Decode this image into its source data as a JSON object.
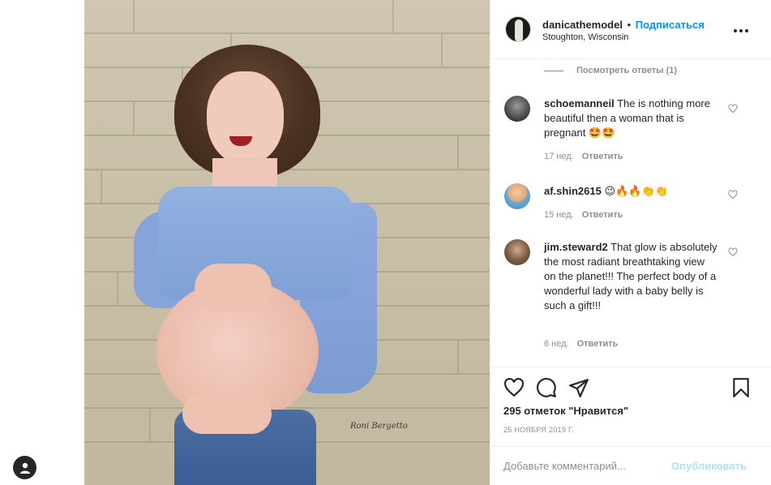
{
  "post": {
    "username": "danicathemodel",
    "separator": "•",
    "follow_label": "Подписаться",
    "location": "Stoughton, Wisconsin",
    "photo_signature": "Roni Bergetto"
  },
  "comments": {
    "view_replies": "Посмотреть ответы (1)",
    "items": [
      {
        "username": "schoemanneil",
        "text": "The is nothing more beautiful then a woman that is pregnant 🤩🤩",
        "age": "17 нед.",
        "reply_label": "Ответить"
      },
      {
        "username": "af.shin2615",
        "text": "😉🔥🔥👏👏",
        "age": "15 нед.",
        "reply_label": "Ответить"
      },
      {
        "username": "jim.steward2",
        "text": "That glow is absolutely the most radiant breathtaking view on the planet!!! The perfect body of a wonderful lady with a baby belly is such a gift!!!",
        "age": "6 нед.",
        "reply_label": "Ответить"
      }
    ]
  },
  "actions": {
    "likes": "295 отметок \"Нравится\"",
    "date": "25 НОЯБРЯ 2019 Г."
  },
  "composer": {
    "placeholder": "Добавьте комментарий...",
    "post_label": "Опубликовать"
  },
  "colors": {
    "accent": "#0095f6",
    "accent_disabled": "#b2dffc",
    "text": "#262626",
    "muted": "#8e8e8e",
    "border": "#efefef"
  },
  "icons": {
    "more": "more-dots-icon",
    "heart": "heart-icon",
    "comment": "comment-icon",
    "share": "share-icon",
    "save": "bookmark-icon",
    "profile": "profile-icon"
  }
}
